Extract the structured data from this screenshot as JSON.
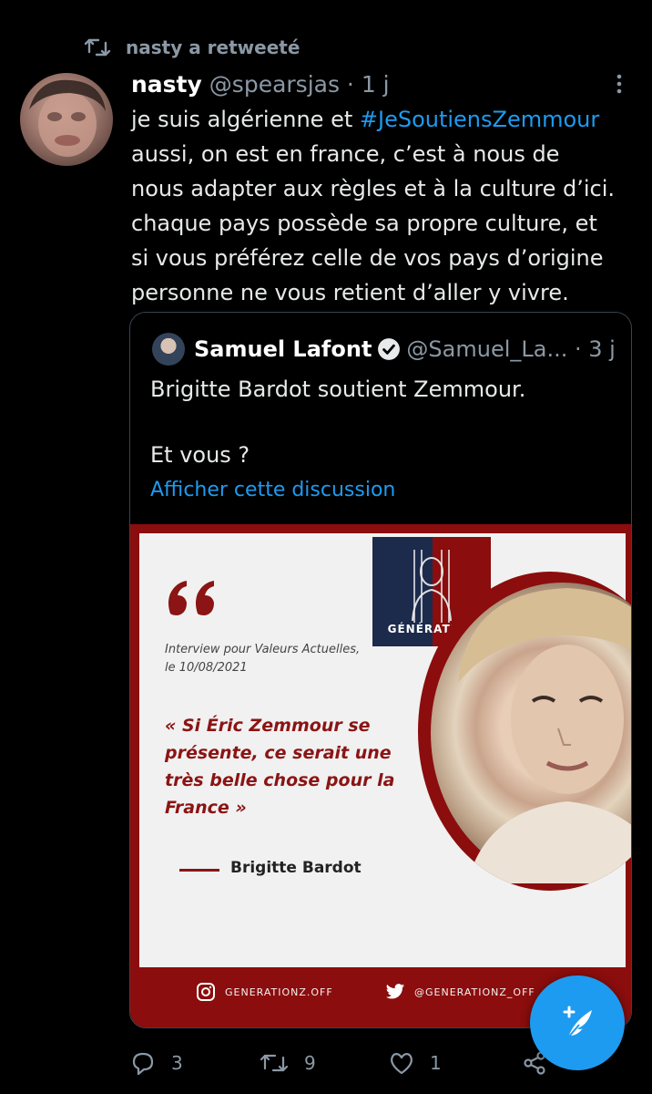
{
  "retweet": {
    "label": "nasty a retweeté",
    "icon": "retweet-icon"
  },
  "tweet": {
    "author_name": "nasty",
    "author_handle": "@spearsjas · 1 j",
    "text_lines": [
      {
        "before": "je suis algérienne et ",
        "hashtag": "#JeSoutiensZemmour"
      },
      {
        "text": "aussi, on est en france, c’est à nous de"
      },
      {
        "text": "nous adapter aux règles et à la culture d’ici."
      },
      {
        "text": "chaque pays possède sa propre culture, et"
      },
      {
        "text": "si vous préférez celle de vos pays d’origine"
      },
      {
        "text": "personne ne vous retient d’aller y vivre."
      }
    ],
    "more_icon": "more-vertical-icon"
  },
  "quote": {
    "author_name": "Samuel Lafont",
    "author_handle": "@Samuel_La... · 3 j",
    "text": "Brigitte Bardot soutient Zemmour.\n\nEt vous ?",
    "show_thread": "Afficher cette discussion",
    "image": {
      "interview_line1": "Interview pour Valeurs Actuelles,",
      "interview_line2": "le 10/08/2021",
      "quote_line1": "« Si Éric Zemmour se",
      "quote_line2": "présente, ce serait une",
      "quote_line3": "très belle chose pour la",
      "quote_line4": "France »",
      "signature": "Brigitte Bardot",
      "logo_word": "GÉNÉRATION",
      "instagram": "GENERATIONZ.OFF",
      "twitter": "@GENERATIONZ_OFF"
    }
  },
  "actions": {
    "reply_count": "3",
    "retweet_count": "9",
    "like_count": "1"
  },
  "colors": {
    "accent": "#1d9bf0",
    "muted": "#8b98a5",
    "background": "#000000",
    "brand_red": "#8b0d0d"
  }
}
